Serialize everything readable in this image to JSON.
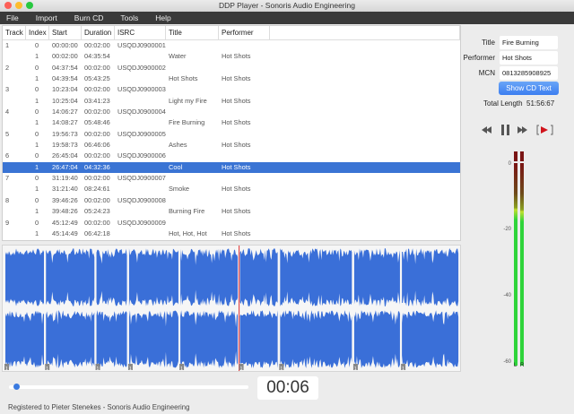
{
  "window": {
    "title": "DDP Player - Sonoris Audio Engineering"
  },
  "menu": [
    "File",
    "Import",
    "Burn CD",
    "Tools",
    "Help"
  ],
  "table": {
    "columns": [
      "Track",
      "Index",
      "Start",
      "Duration",
      "ISRC",
      "Title",
      "Performer",
      ""
    ],
    "rows": [
      [
        "1",
        "0",
        "00:00:00",
        "00:02:00",
        "USQDJ0900001",
        "",
        ""
      ],
      [
        "",
        "1",
        "00:02:00",
        "04:35:54",
        "",
        "Water",
        "Hot Shots"
      ],
      [
        "2",
        "0",
        "04:37:54",
        "00:02:00",
        "USQDJ0900002",
        "",
        ""
      ],
      [
        "",
        "1",
        "04:39:54",
        "05:43:25",
        "",
        "Hot Shots",
        "Hot Shots"
      ],
      [
        "3",
        "0",
        "10:23:04",
        "00:02:00",
        "USQDJ0900003",
        "",
        ""
      ],
      [
        "",
        "1",
        "10:25:04",
        "03:41:23",
        "",
        "Light my Fire",
        "Hot Shots"
      ],
      [
        "4",
        "0",
        "14:06:27",
        "00:02:00",
        "USQDJ0900004",
        "",
        ""
      ],
      [
        "",
        "1",
        "14:08:27",
        "05:48:46",
        "",
        "Fire Burning",
        "Hot Shots"
      ],
      [
        "5",
        "0",
        "19:56:73",
        "00:02:00",
        "USQDJ0900005",
        "",
        ""
      ],
      [
        "",
        "1",
        "19:58:73",
        "06:46:06",
        "",
        "Ashes",
        "Hot Shots"
      ],
      [
        "6",
        "0",
        "26:45:04",
        "00:02:00",
        "USQDJ0900006",
        "",
        ""
      ],
      [
        "",
        "1",
        "26:47:04",
        "04:32:36",
        "",
        "Cool",
        "Hot Shots"
      ],
      [
        "7",
        "0",
        "31:19:40",
        "00:02:00",
        "USQDJ0900007",
        "",
        ""
      ],
      [
        "",
        "1",
        "31:21:40",
        "08:24:61",
        "",
        "Smoke",
        "Hot Shots"
      ],
      [
        "8",
        "0",
        "39:46:26",
        "00:02:00",
        "USQDJ0900008",
        "",
        ""
      ],
      [
        "",
        "1",
        "39:48:26",
        "05:24:23",
        "",
        "Burning Fire",
        "Hot Shots"
      ],
      [
        "9",
        "0",
        "45:12:49",
        "00:02:00",
        "USQDJ0900009",
        "",
        ""
      ],
      [
        "",
        "1",
        "45:14:49",
        "06:42:18",
        "",
        "Hot, Hot, Hot",
        "Hot Shots"
      ]
    ],
    "selected_row": 11
  },
  "info": {
    "title_label": "Title",
    "title_value": "Fire Burning",
    "performer_label": "Performer",
    "performer_value": "Hot Shots",
    "mcn_label": "MCN",
    "mcn_value": "0813285908925",
    "show_cd_text": "Show CD Text",
    "total_length_label": "Total Length",
    "total_length_value": "51:56:67"
  },
  "transport": {
    "icons": [
      "rewind-icon",
      "pause-icon",
      "fast-forward-icon",
      "play-selection-icon"
    ]
  },
  "meter": {
    "labels": [
      "0",
      "-20",
      "-40",
      "-60"
    ],
    "channels": [
      "L",
      "R"
    ],
    "level_db": [
      -14,
      -14
    ],
    "peak_hold": true
  },
  "waveform": {
    "index_marker": "1",
    "color": "#3a6fd8",
    "playhead_track": 6
  },
  "playback": {
    "time": "00:06",
    "progress": 0.02
  },
  "status": "Registered to Pieter Stenekes - Sonoris Audio Engineering"
}
